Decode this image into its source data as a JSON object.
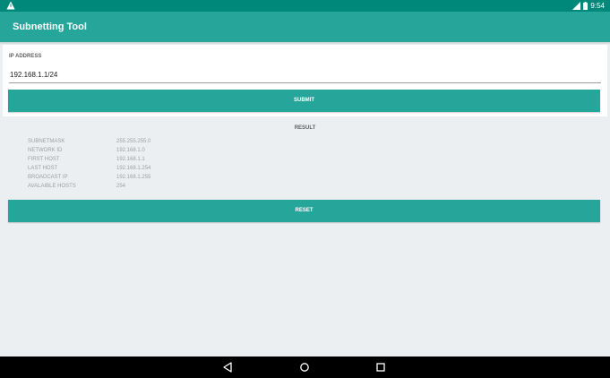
{
  "status_bar": {
    "time": "9:54",
    "icons": [
      "warning-icon",
      "signal-icon",
      "battery-icon"
    ]
  },
  "app": {
    "title": "Subnetting Tool"
  },
  "form": {
    "ip_label": "IP ADDRESS",
    "ip_value": "192.168.1.1/24",
    "submit_label": "SUBMIT"
  },
  "result": {
    "title": "RESULT",
    "rows": [
      {
        "label": "SUBNETMASK",
        "value": "255.255.255.0"
      },
      {
        "label": "NETWORK ID",
        "value": "192.168.1.0"
      },
      {
        "label": "FIRST HOST",
        "value": "192.168.1.1"
      },
      {
        "label": "LAST HOST",
        "value": "192.168.1.254"
      },
      {
        "label": "BROADCAST IP",
        "value": "192.168.1.255"
      },
      {
        "label": "AVALAIBLE HOSTS",
        "value": "254"
      }
    ],
    "reset_label": "RESET"
  },
  "nav_bar": {
    "icons": [
      "back-icon",
      "home-icon",
      "recents-icon"
    ]
  },
  "colors": {
    "status_bar": "#00897b",
    "app_bar": "#26a69a",
    "button": "#26a69a",
    "background": "#eceff1"
  }
}
